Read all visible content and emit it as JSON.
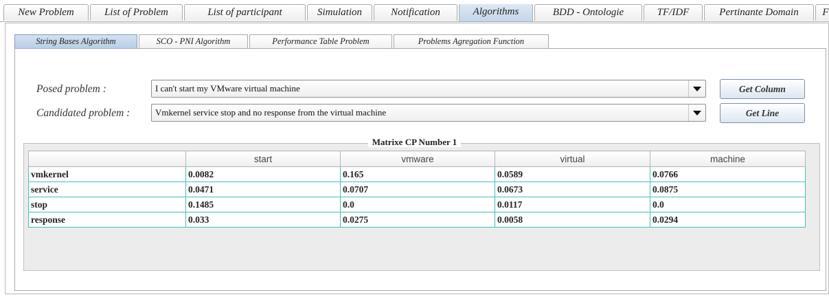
{
  "top_tabs": [
    {
      "label": "New Problem",
      "active": false
    },
    {
      "label": "List of Problem",
      "active": false
    },
    {
      "label": "List of participant",
      "active": false
    },
    {
      "label": "Simulation",
      "active": false
    },
    {
      "label": "Notification",
      "active": false
    },
    {
      "label": "Algorithms",
      "active": true
    },
    {
      "label": "BDD - Ontologie",
      "active": false
    },
    {
      "label": "TF/IDF",
      "active": false
    },
    {
      "label": "Pertinante Domain",
      "active": false
    },
    {
      "label": "F",
      "active": false
    }
  ],
  "sub_tabs": [
    {
      "label": "String Bases Algorithm",
      "active": true
    },
    {
      "label": "SCO - PNI Algorithm",
      "active": false
    },
    {
      "label": "Performance Table Problem",
      "active": false
    },
    {
      "label": "Problems Agregation Function",
      "active": false
    }
  ],
  "form": {
    "posed_label": "Posed problem :",
    "posed_value": "I can't start my VMware virtual machine",
    "candidated_label": "Candidated problem :",
    "candidated_value": "Vmkernel service stop and no response from the virtual machine",
    "get_column_label": "Get Column",
    "get_line_label": "Get Line"
  },
  "matrix": {
    "title": "Matrixe CP Number 1",
    "columns": [
      "",
      "start",
      "vmware",
      "virtual",
      "machine"
    ],
    "rows": [
      [
        "vmkernel",
        "0.0082",
        "0.165",
        "0.0589",
        "0.0766"
      ],
      [
        "service",
        "0.0471",
        "0.0707",
        "0.0673",
        "0.0875"
      ],
      [
        "stop",
        "0.1485",
        "0.0",
        "0.0117",
        "0.0"
      ],
      [
        "response",
        "0.033",
        "0.0275",
        "0.0058",
        "0.0294"
      ]
    ]
  }
}
